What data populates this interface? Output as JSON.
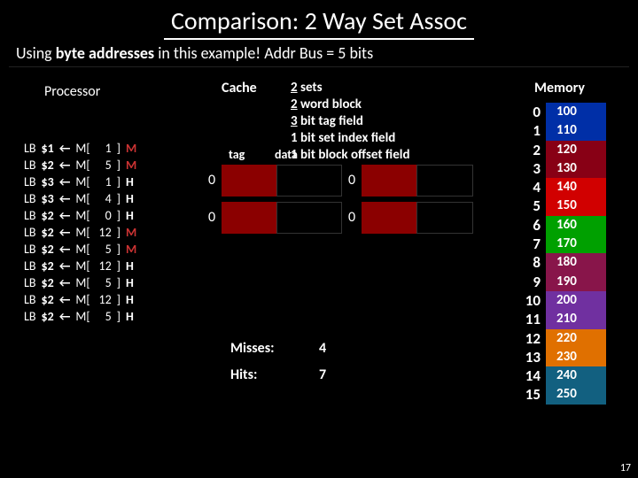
{
  "title": "Comparison: 2 Way Set Assoc",
  "subtitle_pre": "Using ",
  "subtitle_bold": "byte addresses",
  "subtitle_post": " in this example! Addr Bus = 5 bits",
  "processor_label": "Processor",
  "cache_label": "Cache",
  "memory_label": "Memory",
  "col_tag": "tag",
  "col_data": "data",
  "specs": {
    "l1n": "2",
    "l1": " sets",
    "l2n": "2",
    "l2": " word block",
    "l3n": "3",
    "l3": " bit tag field",
    "l4": "1 bit set index field",
    "l5": "1 bit block offset field"
  },
  "accesses": [
    {
      "op": "LB",
      "reg": "$1",
      "addr": "1",
      "res": "M"
    },
    {
      "op": "LB",
      "reg": "$2",
      "addr": "5",
      "res": "M"
    },
    {
      "op": "LB",
      "reg": "$3",
      "addr": "1",
      "res": "H"
    },
    {
      "op": "LB",
      "reg": "$3",
      "addr": "4",
      "res": "H"
    },
    {
      "op": "LB",
      "reg": "$2",
      "addr": "0",
      "res": "H"
    },
    {
      "op": "LB",
      "reg": "$2",
      "addr": "12",
      "res": "M"
    },
    {
      "op": "LB",
      "reg": "$2",
      "addr": "5",
      "res": "M"
    },
    {
      "op": "LB",
      "reg": "$2",
      "addr": "12",
      "res": "H"
    },
    {
      "op": "LB",
      "reg": "$2",
      "addr": "5",
      "res": "H"
    },
    {
      "op": "LB",
      "reg": "$2",
      "addr": "12",
      "res": "H"
    },
    {
      "op": "LB",
      "reg": "$2",
      "addr": "5",
      "res": "H"
    }
  ],
  "cache_sets": [
    {
      "v0": "0",
      "v1": "0"
    },
    {
      "v0": "0",
      "v1": "0"
    }
  ],
  "stats": {
    "miss_label": "Misses:",
    "miss": "4",
    "hit_label": "Hits:",
    "hit": "7"
  },
  "memory": [
    {
      "i": "0",
      "v": "100",
      "c": "c0"
    },
    {
      "i": "1",
      "v": "110",
      "c": "c0"
    },
    {
      "i": "2",
      "v": "120",
      "c": "c4"
    },
    {
      "i": "3",
      "v": "130",
      "c": "c4"
    },
    {
      "i": "4",
      "v": "140",
      "c": "c2"
    },
    {
      "i": "5",
      "v": "150",
      "c": "c2"
    },
    {
      "i": "6",
      "v": "160",
      "c": "c3"
    },
    {
      "i": "7",
      "v": "170",
      "c": "c3"
    },
    {
      "i": "8",
      "v": "180",
      "c": "c1"
    },
    {
      "i": "9",
      "v": "190",
      "c": "c1"
    },
    {
      "i": "10",
      "v": "200",
      "c": "c5"
    },
    {
      "i": "11",
      "v": "210",
      "c": "c5"
    },
    {
      "i": "12",
      "v": "220",
      "c": "c6"
    },
    {
      "i": "13",
      "v": "230",
      "c": "c6"
    },
    {
      "i": "14",
      "v": "240",
      "c": "c7"
    },
    {
      "i": "15",
      "v": "250",
      "c": "c7"
    }
  ],
  "page_number": "17"
}
